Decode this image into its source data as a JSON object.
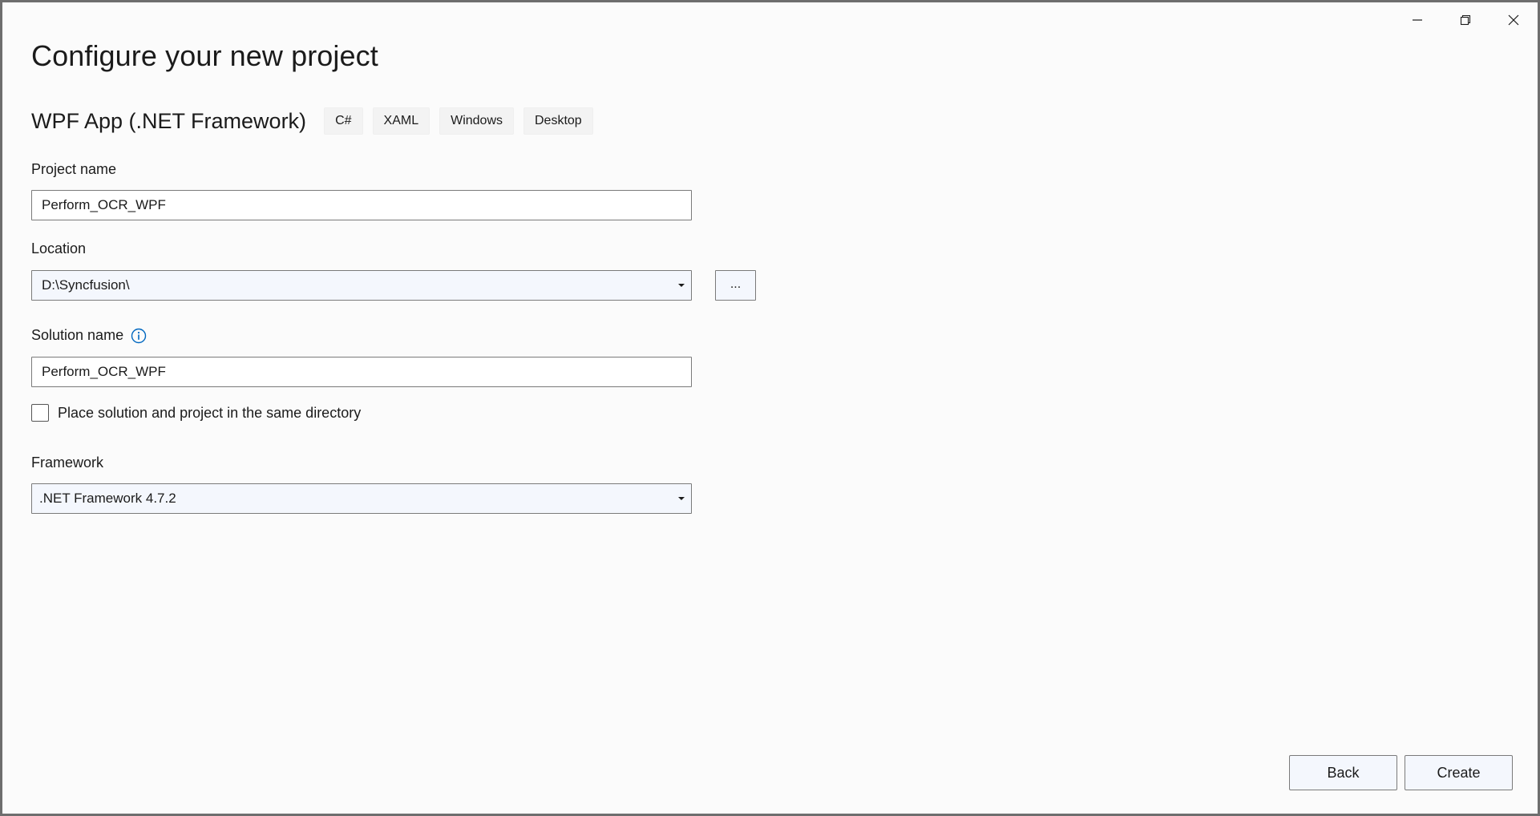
{
  "window": {
    "controls": {
      "minimize_icon": "minimize-icon",
      "restore_icon": "restore-icon",
      "close_icon": "close-icon"
    }
  },
  "page": {
    "title": "Configure your new project"
  },
  "template": {
    "name": "WPF App (.NET Framework)",
    "tags": [
      "C#",
      "XAML",
      "Windows",
      "Desktop"
    ]
  },
  "project_name": {
    "label": "Project name",
    "value": "Perform_OCR_WPF"
  },
  "location": {
    "label": "Location",
    "value": "D:\\Syncfusion\\",
    "browse_label": "..."
  },
  "solution_name": {
    "label": "Solution name",
    "value": "Perform_OCR_WPF",
    "info_icon": "info-icon"
  },
  "same_directory": {
    "label": "Place solution and project in the same directory",
    "checked": false
  },
  "framework": {
    "label": "Framework",
    "value": ".NET Framework 4.7.2"
  },
  "footer": {
    "back_label": "Back",
    "create_label": "Create"
  },
  "colors": {
    "window_bg": "#fbfbfb",
    "border": "#6e6e6e",
    "control_bg": "#f4f7fd",
    "info_blue": "#0067c0"
  }
}
